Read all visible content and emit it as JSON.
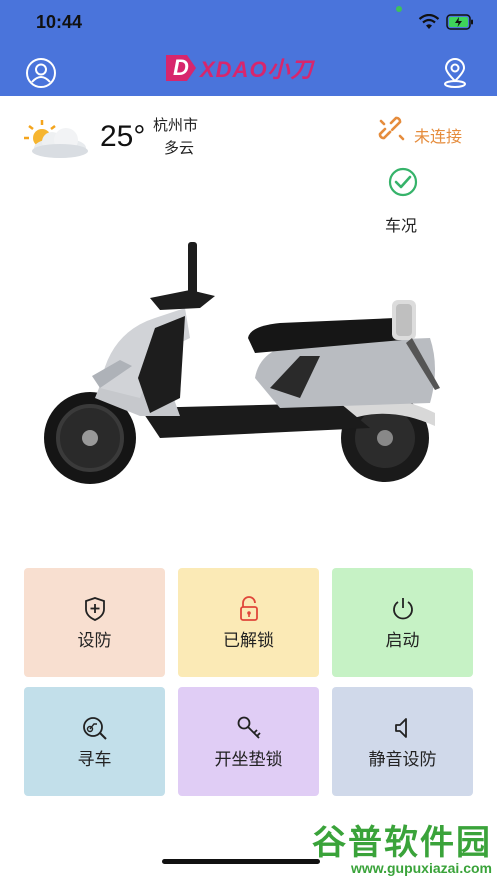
{
  "status_bar": {
    "time": "10:44"
  },
  "header": {
    "logo_mark": "D",
    "logo_text": "XDAO小刀",
    "user_icon": "user-icon",
    "location_icon": "location-pin-icon",
    "color": "#4a74db"
  },
  "weather": {
    "temperature": "25°",
    "city": "杭州市",
    "condition": "多云",
    "icon": "partly-cloudy-icon"
  },
  "connection": {
    "label": "未连接",
    "icon": "broken-link-icon",
    "color": "#e58c3c"
  },
  "vehicle_status": {
    "label": "车况",
    "icon": "check-circle-icon"
  },
  "actions": [
    {
      "label": "设防",
      "icon": "shield-plus-icon",
      "bg": "#f8dfd0"
    },
    {
      "label": "已解锁",
      "icon": "unlock-icon",
      "bg": "#fbeab6"
    },
    {
      "label": "启动",
      "icon": "power-icon",
      "bg": "#c6f2c5"
    },
    {
      "label": "寻车",
      "icon": "find-car-icon",
      "bg": "#c2dfea"
    },
    {
      "label": "开坐垫锁",
      "icon": "key-icon",
      "bg": "#e0cdf5"
    },
    {
      "label": "静音设防",
      "icon": "mute-speaker-icon",
      "bg": "#d0d9ea"
    }
  ],
  "watermark": {
    "main": "谷普软件园",
    "url": "www.gupuxiazai.com"
  }
}
